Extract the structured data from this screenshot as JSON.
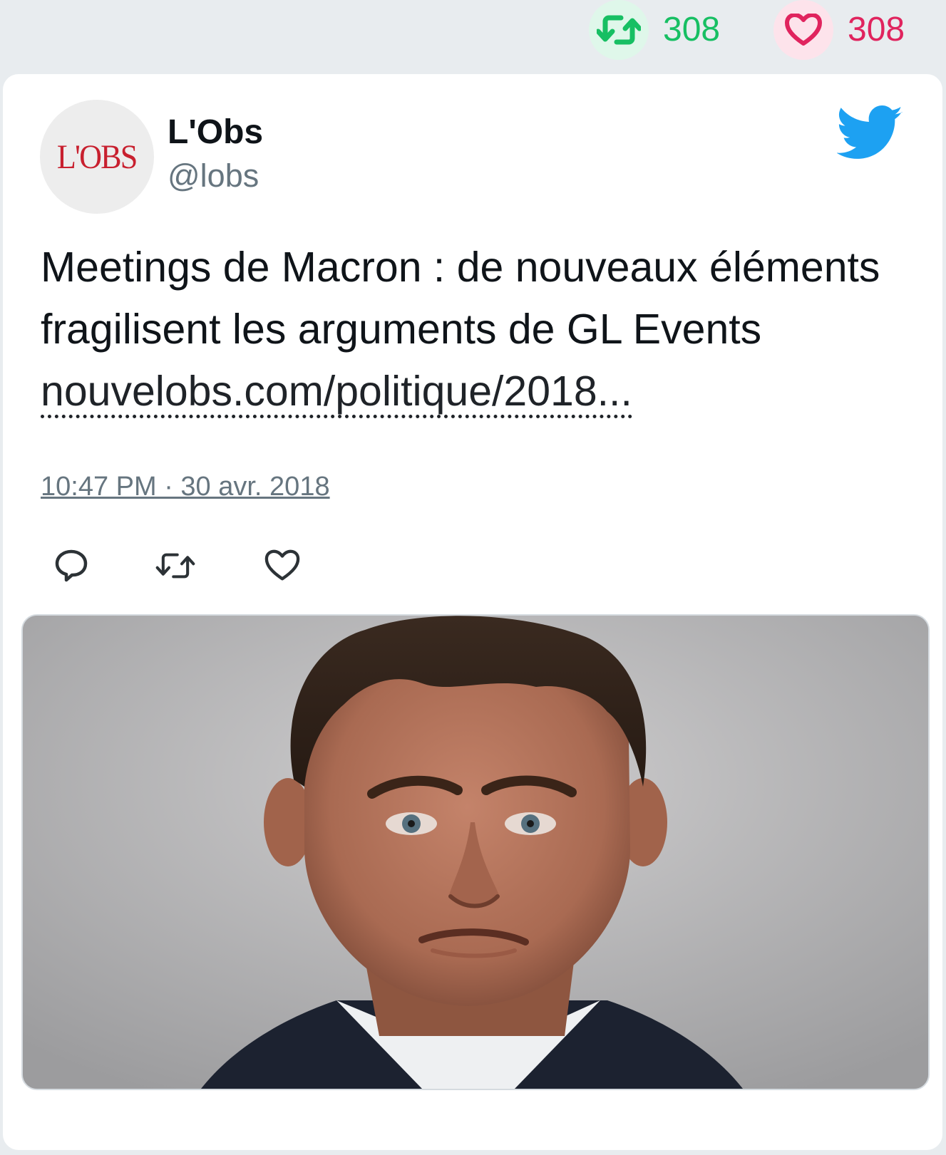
{
  "stats": {
    "retweets": {
      "count": "308",
      "icon": "retweet-icon",
      "color": "#17bf63",
      "bg": "#dff7ea"
    },
    "likes": {
      "count": "308",
      "icon": "heart-icon",
      "color": "#e0245e",
      "bg": "#fde3eb"
    }
  },
  "tweet": {
    "author": {
      "name": "L'Obs",
      "handle": "@lobs",
      "avatar_text": "L'OBS",
      "avatar_color": "#c8202f"
    },
    "text": "Meetings de Macron : de nouveaux éléments fragilisent les arguments de GL Events ",
    "link": "nouvelobs.com/politique/2018...",
    "timestamp": "10:47 PM · 30 avr. 2018",
    "brand_icon": "twitter-bird-icon",
    "brand_color": "#1da1f2",
    "actions": [
      "reply-icon",
      "retweet-icon",
      "like-icon"
    ],
    "media": {
      "type": "photo"
    }
  }
}
